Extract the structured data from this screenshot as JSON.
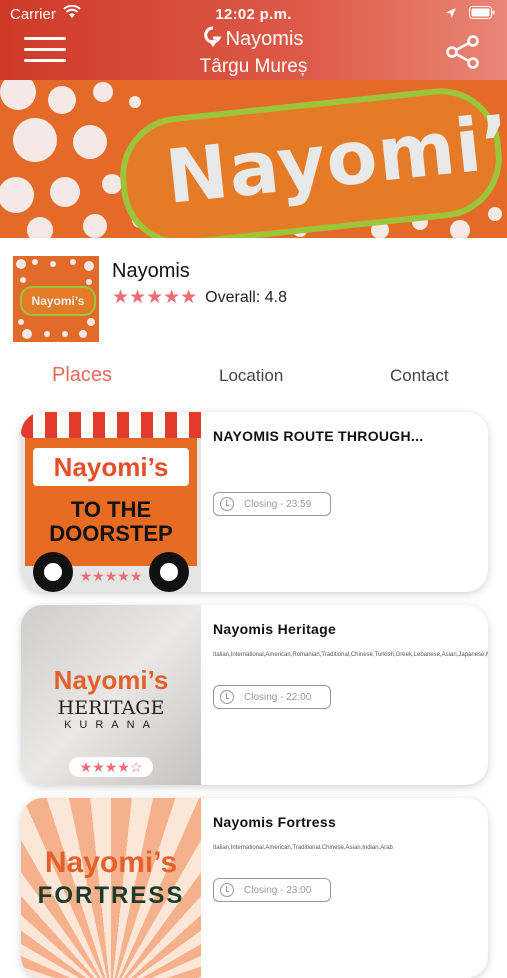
{
  "status_bar": {
    "carrier": "Carrier",
    "time": "12:02 p.m."
  },
  "header": {
    "brand": "Nayomis",
    "city": "Târgu Mureș"
  },
  "banner": {
    "logo_text": "Nayomi’s"
  },
  "business": {
    "name": "Nayomis",
    "stars": "★★★★★",
    "overall": "Overall: 4.8",
    "logo_text": "Nayomi’s"
  },
  "tabs": [
    {
      "label": "Places",
      "active": true
    },
    {
      "label": "Location",
      "active": false
    },
    {
      "label": "Contact",
      "active": false
    }
  ],
  "places": [
    {
      "name": "NAYOMIS ROUTE THROUGH...",
      "cuisine": "",
      "closing": "Closing - 23:59",
      "stars": "★★★★★",
      "image": {
        "sign": "Nayomi’s",
        "line1": "TO THE",
        "line2": "DOORSTEP"
      }
    },
    {
      "name": "Nayomis Heritage",
      "cuisine": "Italian,International,American,Romanian,Traditional,Chinese,Turkish,Greek,Lebanese,Asian,Japanese,Mexican,Indian,Arab,Thai,Spanish",
      "closing": "Closing - 22:00",
      "stars": "★★★★☆",
      "image": {
        "line1": "Nayomi’s",
        "line2": "HERITAGE",
        "line3": "KURANA"
      }
    },
    {
      "name": "Nayomis Fortress",
      "cuisine": "Italian,International,American,Traditional,Chinese,Asian,Indian,Arab",
      "closing": "Closing - 23:00",
      "image": {
        "line1": "Nayomi’s",
        "line2": "FORTRESS"
      }
    }
  ]
}
